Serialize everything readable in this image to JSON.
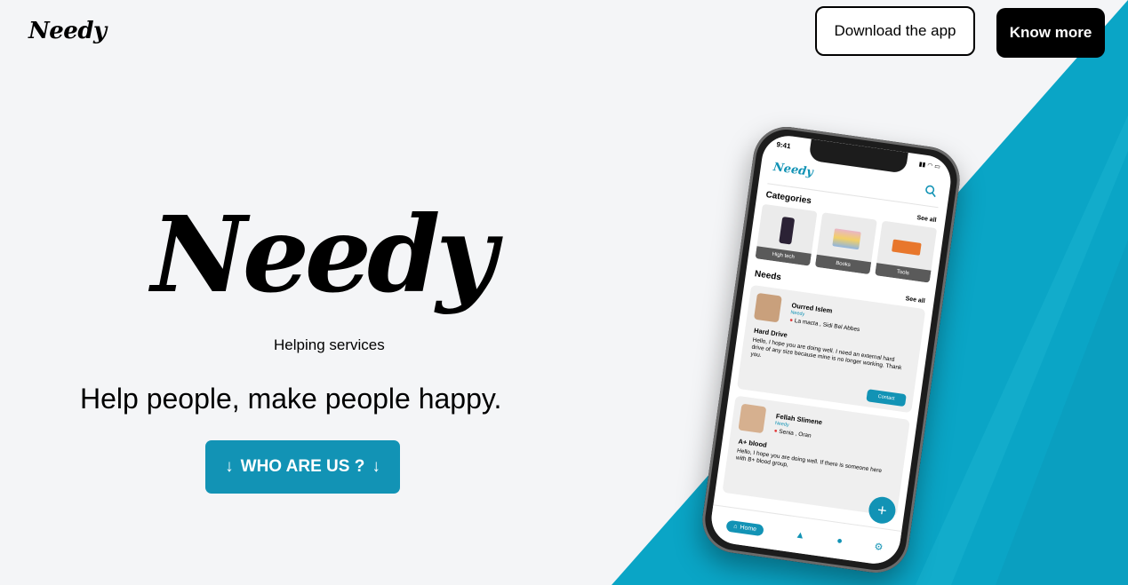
{
  "colors": {
    "accent": "#1293b5",
    "dark": "#000000",
    "background": "#f4f5f7"
  },
  "header": {
    "logo": "Needy",
    "download_label": "Download the app",
    "know_more_label": "Know more"
  },
  "hero": {
    "brand": "Needy",
    "subtitle": "Helping services",
    "tagline": "Help people, make people happy.",
    "cta_label": "WHO ARE US ?",
    "cta_icon": "arrow-down-icon"
  },
  "phone": {
    "status_time": "9:41",
    "app_logo": "Needy",
    "search_icon": "search-icon",
    "categories_title": "Categories",
    "categories_see_all": "See all",
    "categories": [
      {
        "label": "High tech",
        "icon": "phone-icon"
      },
      {
        "label": "Books",
        "icon": "books-icon"
      },
      {
        "label": "Tools",
        "icon": "paint-roller-icon"
      }
    ],
    "needs_title": "Needs",
    "needs_see_all": "See all",
    "needs": [
      {
        "name": "Ourred Islem",
        "role": "Needy",
        "location": "La macta , Sidi Bel Abbes",
        "title": "Hard Drive",
        "body": "Hello, I hope you are doing well. I need an external hard drive of any size because mine is no longer working. Thank you.",
        "contact_label": "Contact"
      },
      {
        "name": "Fellah Slimene",
        "role": "Needy",
        "location": "Senia , Oran",
        "title": "A+ blood",
        "body": "Hello, I hope you are doing well. If there is someone here with B+ blood group,"
      }
    ],
    "fab_icon": "plus-icon",
    "nav": {
      "home_label": "Home",
      "icons": [
        "home-icon",
        "categories-icon",
        "location-pin-icon",
        "settings-gear-icon"
      ]
    }
  }
}
